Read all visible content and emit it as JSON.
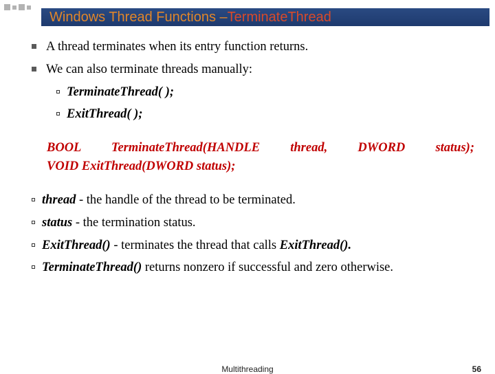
{
  "title": {
    "part1": "Windows Thread Functions – ",
    "part2": "TerminateThread"
  },
  "bullets": {
    "b1": "A thread terminates when its entry function returns.",
    "b2": "We can also terminate threads manually:",
    "b2a": "TerminateThread( );",
    "b2b": "ExitThread( );"
  },
  "signatures": {
    "line1": "BOOL TerminateThread(HANDLE thread, DWORD status);",
    "line2": "VOID ExitThread(DWORD status);"
  },
  "params": {
    "p1_name": "thread",
    "p1_desc": "  - the handle of the thread to be terminated.",
    "p2_name": "status",
    "p2_desc": " -  the termination status.",
    "p3_name": "ExitThread()",
    "p3_mid": " - terminates the thread that calls ",
    "p3_end": "ExitThread().",
    "p4_name": "TerminateThread()",
    "p4_desc": " returns nonzero if successful and zero otherwise."
  },
  "footer": {
    "text": "Multithreading",
    "page": "56"
  }
}
